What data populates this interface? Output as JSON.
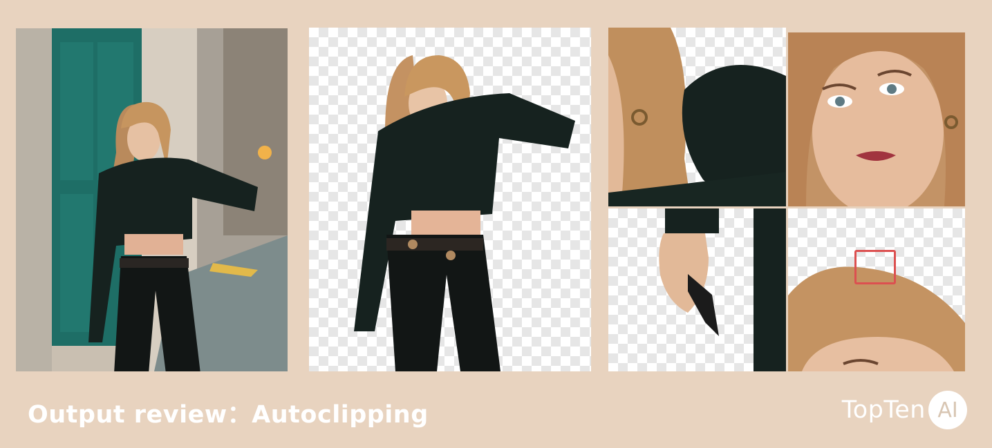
{
  "caption": "Output review：Autoclipping",
  "logo": {
    "text": "TopTen",
    "badge": "AI"
  },
  "images": {
    "original": "original-street-photo",
    "cutout": "background-removed-cutout",
    "detail_hair_arm": "detail-hair-and-arm",
    "detail_face": "detail-face",
    "detail_hand": "detail-hand",
    "detail_hair_edge": "detail-hair-edge-highlight"
  },
  "colors": {
    "background": "#e8d3bf",
    "highlight": "#dc5050",
    "text": "#ffffff"
  }
}
